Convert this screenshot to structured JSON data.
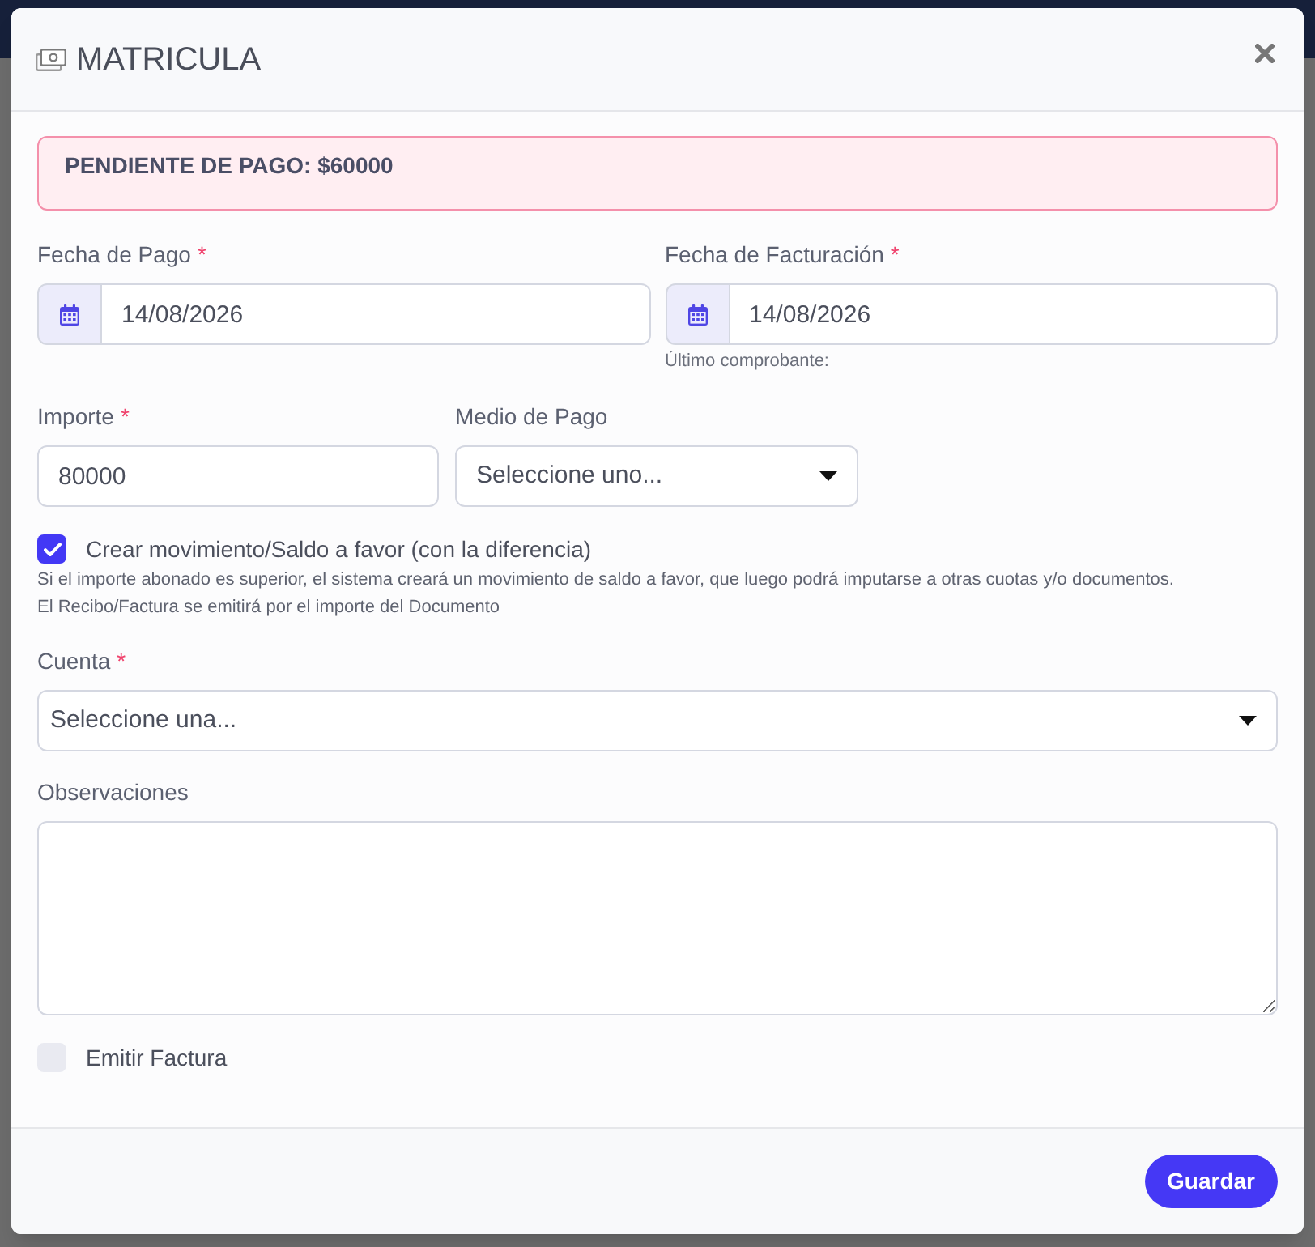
{
  "window": {
    "title": "MATRICULA"
  },
  "alert": {
    "text": "PENDIENTE DE PAGO: $60000"
  },
  "fecha_pago": {
    "label": "Fecha de Pago",
    "required_mark": "*",
    "value": "14/08/2026"
  },
  "fecha_facturacion": {
    "label": "Fecha de Facturación",
    "required_mark": "*",
    "value": "14/08/2026",
    "hint": "Último comprobante:"
  },
  "importe": {
    "label": "Importe",
    "required_mark": "*",
    "value": "80000"
  },
  "medio_pago": {
    "label": "Medio de Pago",
    "value": "Seleccione uno..."
  },
  "crear_movimiento": {
    "label": "Crear movimiento/Saldo a favor (con la diferencia)",
    "checked": true,
    "help": [
      "Si el importe abonado es superior, el sistema creará un movimiento de saldo a favor, que luego podrá imputarse a otras cuotas y/o documentos.",
      "El Recibo/Factura se emitirá por el importe del Documento"
    ]
  },
  "cuenta": {
    "label": "Cuenta",
    "required_mark": "*",
    "value": "Seleccione una..."
  },
  "observaciones": {
    "label": "Observaciones"
  },
  "emitir_factura": {
    "label": "Emitir Factura",
    "checked": false
  },
  "footer": {
    "buttons": [
      {
        "label": "Guardar"
      }
    ]
  }
}
